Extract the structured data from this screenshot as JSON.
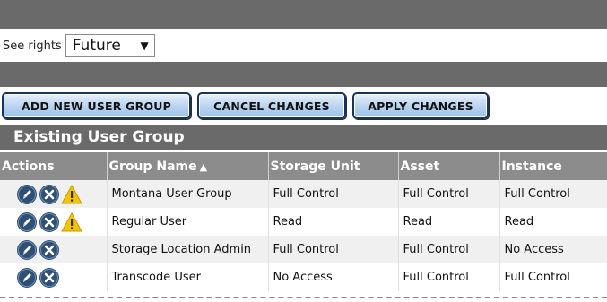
{
  "rights": {
    "label": "See rights",
    "selected": "Future",
    "caret": "▼"
  },
  "buttons": {
    "add": "ADD NEW USER GROUP",
    "cancel": "CANCEL CHANGES",
    "apply": "APPLY CHANGES"
  },
  "section_title": "Existing User Group",
  "table": {
    "headers": {
      "actions": "Actions",
      "group_name": "Group Name",
      "sort": "▲",
      "storage_unit": "Storage Unit",
      "asset": "Asset",
      "instance": "Instance"
    },
    "rows": [
      {
        "group_name": "Montana User Group",
        "storage_unit": "Full Control",
        "asset": "Full Control",
        "instance": "Full Control",
        "warning": true
      },
      {
        "group_name": "Regular User",
        "storage_unit": "Read",
        "asset": "Read",
        "instance": "Read",
        "warning": true
      },
      {
        "group_name": "Storage Location Admin",
        "storage_unit": "Full Control",
        "asset": "Full Control",
        "instance": "No Access",
        "warning": false
      },
      {
        "group_name": "Transcode User",
        "storage_unit": "No Access",
        "asset": "Full Control",
        "instance": "Full Control",
        "warning": false
      }
    ]
  },
  "icons": {
    "edit": "pencil-icon",
    "delete": "close-icon",
    "warning": "warning-icon"
  },
  "colors": {
    "header_bar": "#6a6a6a",
    "column_header": "#8c8c8c",
    "button": "#b7d2ef",
    "icon": "#2f4f75",
    "warning": "#f5c400"
  }
}
